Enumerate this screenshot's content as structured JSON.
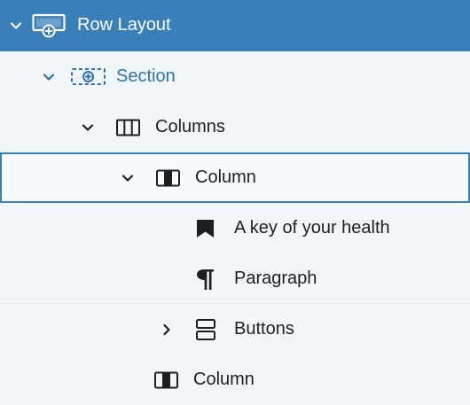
{
  "tree": {
    "items": [
      {
        "label": "Row Layout",
        "icon": "row-layout-icon",
        "expanded": true,
        "selected": true
      },
      {
        "label": "Section",
        "icon": "section-icon",
        "expanded": true
      },
      {
        "label": "Columns",
        "icon": "columns-icon",
        "expanded": true
      },
      {
        "label": "Column",
        "icon": "column-icon",
        "expanded": true,
        "focused": true
      },
      {
        "label": "A key of your health",
        "icon": "bookmark-icon"
      },
      {
        "label": "Paragraph",
        "icon": "paragraph-icon"
      },
      {
        "label": "Buttons",
        "icon": "buttons-icon",
        "expanded": false
      },
      {
        "label": "Column",
        "icon": "column-icon"
      }
    ]
  },
  "colors": {
    "selected_bg": "#3a80b8",
    "accent_text": "#2f73ad",
    "panel_bg": "#f1f6fb"
  }
}
